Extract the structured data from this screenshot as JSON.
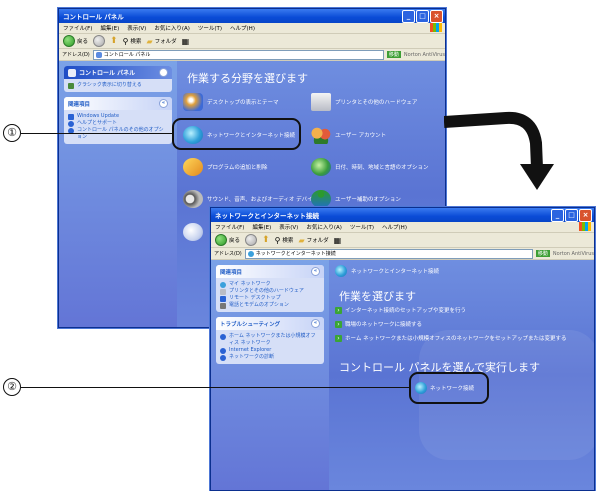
{
  "window1": {
    "title": "コントロール パネル",
    "menu": [
      "ファイル(F)",
      "編集(E)",
      "表示(V)",
      "お気に入り(A)",
      "ツール(T)",
      "ヘルプ(H)"
    ],
    "toolbar": {
      "back": "戻る",
      "search": "検索",
      "folders": "フォルダ"
    },
    "address_label": "アドレス(D)",
    "address_value": "コントロール パネル",
    "go_label": "移動",
    "norton": "Norton AntiVirus",
    "side_title": "コントロール パネル",
    "side_switch": "クラシック表示に切り替える",
    "side_related_title": "関連項目",
    "side_related": [
      "Windows Update",
      "ヘルプとサポート",
      "コントロール パネルのその他のオプション"
    ],
    "heading": "作業する分野を選びます",
    "categories": [
      "デスクトップの表示とテーマ",
      "プリンタとその他のハードウェア",
      "ネットワークとインターネット接続",
      "ユーザー アカウント",
      "プログラムの追加と削除",
      "日付、時刻、地域と言語のオプション",
      "サウンド、音声、およびオーディオ デバイス",
      "ユーザー補助のオプション"
    ]
  },
  "window2": {
    "title": "ネットワークとインターネット接続",
    "menu": [
      "ファイル(F)",
      "編集(E)",
      "表示(V)",
      "お気に入り(A)",
      "ツール(T)",
      "ヘルプ(H)"
    ],
    "toolbar": {
      "back": "戻る",
      "search": "検索",
      "folders": "フォルダ"
    },
    "address_label": "アドレス(D)",
    "address_value": "ネットワークとインターネット接続",
    "go_label": "移動",
    "norton": "Norton AntiVirus",
    "side_related_title": "関連項目",
    "side_related": [
      "マイ ネットワーク",
      "プリンタとその他のハードウェア",
      "リモート デスクトップ",
      "電話とモデムのオプション"
    ],
    "side_trouble_title": "トラブルシューティング",
    "side_trouble": [
      "ホーム ネットワークまたは小規模オフィス ネットワーク",
      "Internet Explorer",
      "ネットワークの診断"
    ],
    "page_title": "ネットワークとインターネット接続",
    "heading": "作業を選びます",
    "tasks": [
      "インターネット接続のセットアップや変更を行う",
      "職場のネットワークに接続する",
      "ホーム ネットワークまたは小規模オフィスのネットワークをセットアップまたは変更する"
    ],
    "heading2": "コントロール パネルを選んで実行します",
    "network_connections": "ネットワーク接続"
  },
  "callouts": {
    "one": "①",
    "two": "②"
  }
}
